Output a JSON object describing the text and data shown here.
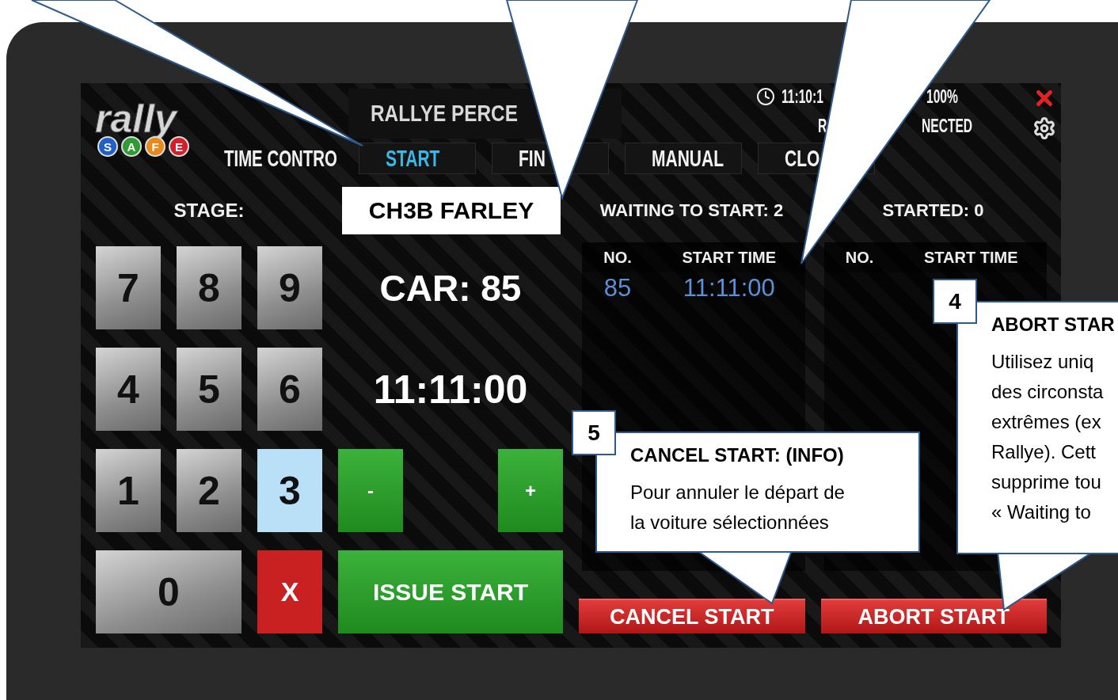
{
  "logo": {
    "word": "rally",
    "letters": [
      {
        "letter": "S",
        "color": "#1f5fc6"
      },
      {
        "letter": "A",
        "color": "#2e9b33"
      },
      {
        "letter": "F",
        "color": "#e8891a"
      },
      {
        "letter": "E",
        "color": "#d3202a"
      }
    ]
  },
  "header": {
    "title": "RALLYE PERCE",
    "clock": "11:10:1",
    "battery": "100%",
    "connection": [
      "R",
      "NECTED"
    ]
  },
  "tabs_label": "TIME CONTRO",
  "tabs": [
    {
      "label": "START",
      "selected": true
    },
    {
      "label": "FIN",
      "selected": false
    },
    {
      "label": "MANUAL",
      "selected": false
    },
    {
      "label": "CLO",
      "selected": false
    }
  ],
  "stage": {
    "label": "STAGE:",
    "value": "CH3B FARLEY"
  },
  "waiting": {
    "title": "WAITING TO START: 2",
    "columns": [
      "NO.",
      "START TIME"
    ],
    "rows": [
      [
        "85",
        "11:11:00"
      ]
    ]
  },
  "started": {
    "title": "STARTED: 0",
    "columns": [
      "NO.",
      "START TIME"
    ]
  },
  "keypad": [
    {
      "label": "7",
      "kind": "digit",
      "selected": false
    },
    {
      "label": "8",
      "kind": "digit",
      "selected": false
    },
    {
      "label": "9",
      "kind": "digit",
      "selected": false
    },
    {
      "label": "4",
      "kind": "digit",
      "selected": false
    },
    {
      "label": "5",
      "kind": "digit",
      "selected": false
    },
    {
      "label": "6",
      "kind": "digit",
      "selected": false
    },
    {
      "label": "1",
      "kind": "digit",
      "selected": false
    },
    {
      "label": "2",
      "kind": "digit",
      "selected": false
    },
    {
      "label": "3",
      "kind": "digit",
      "selected": true
    },
    {
      "label": "0",
      "kind": "wide",
      "selected": false
    },
    {
      "label": "X",
      "kind": "clear",
      "selected": false
    }
  ],
  "car": "CAR: 85",
  "time": "11:11:00",
  "adjust": [
    "-",
    "+"
  ],
  "issue": "ISSUE START",
  "actions": [
    "CANCEL START",
    "ABORT START"
  ],
  "callouts": [
    {
      "number": "5",
      "title": "CANCEL START: (INFO)",
      "lines": [
        "Pour annuler le départ de",
        "la voiture sélectionnées"
      ]
    },
    {
      "number": "4",
      "title": "ABORT STAR",
      "lines": [
        "Utilisez uniq",
        "des circonsta",
        "extrêmes (ex",
        "Rallye). Cett",
        "supprime tou",
        "« Waiting to"
      ]
    }
  ]
}
